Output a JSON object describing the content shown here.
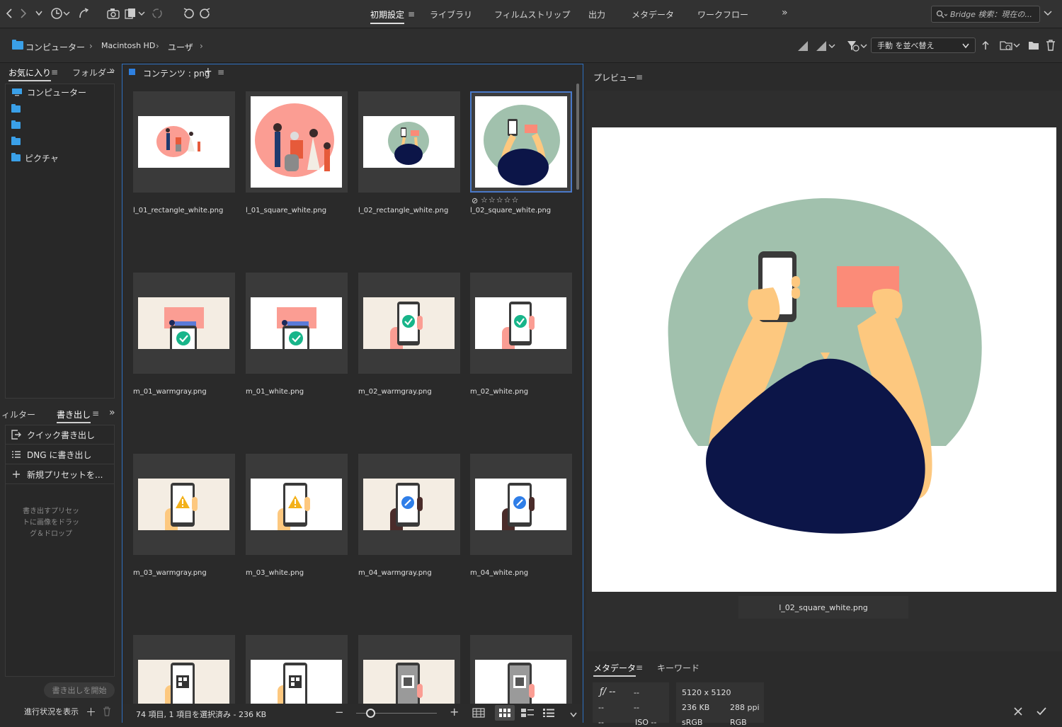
{
  "toolbar": {
    "workspaces": [
      "初期設定",
      "ライブラリ",
      "フィルムストリップ",
      "出力",
      "メタデータ",
      "ワークフロー"
    ],
    "search_placeholder": "Bridge 検索：現在の..."
  },
  "pathbar": {
    "crumbs": [
      "コンピューター",
      "Macintosh HD",
      "ユーザ"
    ],
    "sort_label": "手動 を並べ替え"
  },
  "left": {
    "tab_favorites": "お気に入り",
    "tab_folders": "フォルダー",
    "favorites": [
      "コンピューター",
      "",
      "",
      "",
      "ピクチャ"
    ],
    "tab_filter": "ィルター",
    "tab_export": "書き出し",
    "export_items": [
      "クイック書き出し",
      "DNG に書き出し",
      "新規プリセットを..."
    ],
    "export_hint": "書き出すプリセットに画像をドラッグ＆ドロップ",
    "export_start": "書き出しを開始",
    "progress_label": "進行状況を表示"
  },
  "content": {
    "tab_label": "コンテンツ : png",
    "files": [
      "l_01_rectangle_white.png",
      "l_01_square_white.png",
      "l_02_rectangle_white.png",
      "l_02_square_white.png",
      "m_01_warmgray.png",
      "m_01_white.png",
      "m_02_warmgray.png",
      "m_02_white.png",
      "m_03_warmgray.png",
      "m_03_white.png",
      "m_04_warmgray.png",
      "m_04_white.png",
      "",
      "",
      "",
      ""
    ],
    "status": "74 項目, 1 項目を選択済み - 236 KB",
    "rating_stars": "☆☆☆☆☆"
  },
  "preview": {
    "title": "プレビュー",
    "filename": "l_02_square_white.png"
  },
  "metadata": {
    "tab_metadata": "メタデータ",
    "tab_keywords": "キーワード",
    "aperture": "ƒ/ --",
    "shutter": "--",
    "r2a": "--",
    "r2b": "--",
    "r3a": "--",
    "iso": "ISO --",
    "dimensions": "5120 x 5120",
    "size": "236 KB",
    "ppi": "288 ppi",
    "colorspace": "sRGB",
    "colormode": "RGB"
  },
  "colors": {
    "accent": "#2e6fbf",
    "sage": "#a1c1ad",
    "navy": "#0c1548",
    "skin": "#fdc87f",
    "coral": "#fb8b78",
    "green_check": "#18b58a",
    "warning": "#f3b11b",
    "blue_icon": "#2f7ee8"
  }
}
